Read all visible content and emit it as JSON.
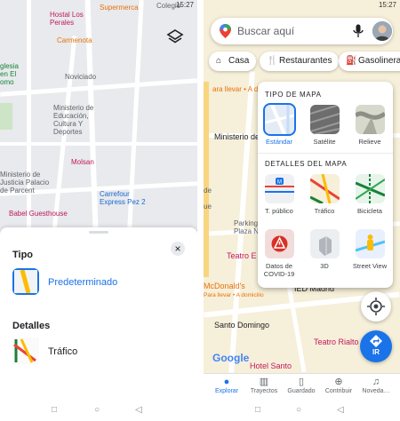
{
  "left_screen": {
    "status": {
      "time": "15:27"
    },
    "map_labels": {
      "hostal_los_perales": "Hostal Los\nPerales",
      "carmenota": "Carmenota",
      "iglesia": "glesia\nen El\nomo",
      "noviciado_street": "Noviciado",
      "ministerio": "Ministerio de\nEducación,\nCultura Y\nDeportes",
      "molsan": "Molsan",
      "palacio": "Ministerio de\nJusticia Palacio\nde Parcent",
      "carrefour": "Carrefour\nExpress Pez 2",
      "babel": "Babel Guesthouse",
      "supermercado": "Supermerca",
      "colegio": "Colegio"
    },
    "sheet": {
      "tipo_heading": "Tipo",
      "tipo_option": "Predeterminado",
      "detalles_heading": "Detalles",
      "detalles_option": "Tráfico",
      "close": "×"
    }
  },
  "right_screen": {
    "status": {
      "time": "15:27"
    },
    "search": {
      "placeholder": "Buscar aquí"
    },
    "chips": [
      "Casa",
      "Restaurantes",
      "Gasolineras"
    ],
    "chip_icons": [
      "⌂",
      "🍴",
      "⛽"
    ],
    "panel": {
      "tipo_heading": "TIPO DE MAPA",
      "tipos": [
        "Estándar",
        "Satélite",
        "Relieve"
      ],
      "detalles_heading": "DETALLES DEL MAPA",
      "detalles_row1": [
        "T. público",
        "Tráfico",
        "Bicicleta"
      ],
      "detalles_row2": [
        "Datos de\nCOVID-19",
        "3D",
        "Street View"
      ]
    },
    "map_labels": {
      "ministerio_short": "Ministerio de",
      "parking": "Parking\nPlaza N",
      "teatro_e": "Teatro E",
      "mcdonalds": "McDonald's",
      "ied": "IED Madrid",
      "santo_domingo": "Santo Domingo",
      "teatro_rialto": "Teatro Rialto",
      "hotel_santo": "Hotel Santo",
      "para_llevar": "ara llevar • A domicilio",
      "mcd_sub": "Para llevar • A domicilio",
      "travesti": "Travesía",
      "de": "de",
      "ue": "ue",
      "fernando": "Fernando"
    },
    "go_label": "IR",
    "google": "Google",
    "bottom_nav": [
      "Explorar",
      "Trayectos",
      "Guardado",
      "Contribuir",
      "Novedades"
    ],
    "bottom_nav_short": [
      "Explorar",
      "Trayectos",
      "Guardado",
      "Contribuir",
      "Noveda…"
    ],
    "colors": {
      "accent": "#1a73e8",
      "google_red": "#ea4335"
    }
  },
  "system_nav": {
    "square": "□",
    "circle": "○",
    "back": "◁"
  }
}
